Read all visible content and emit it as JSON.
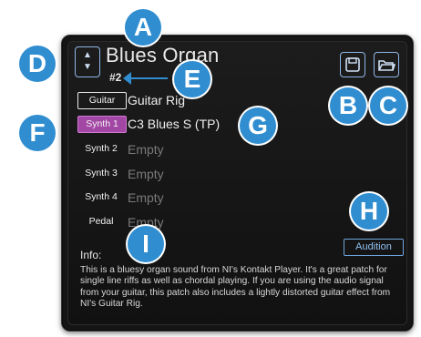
{
  "preset": {
    "name": "Blues Organ",
    "number": "#2",
    "spin_up": "▲",
    "spin_down": "▼"
  },
  "toolbar": {
    "save_icon": "save-icon",
    "open_icon": "folder-open-icon"
  },
  "slots": [
    {
      "label": "Guitar",
      "value": "Guitar Rig",
      "state": "loaded"
    },
    {
      "label": "Synth 1",
      "value": "C3 Blues S (TP)",
      "state": "selected"
    },
    {
      "label": "Synth 2",
      "value": "Empty",
      "state": "empty"
    },
    {
      "label": "Synth 3",
      "value": "Empty",
      "state": "empty"
    },
    {
      "label": "Synth 4",
      "value": "Empty",
      "state": "empty"
    },
    {
      "label": "Pedal",
      "value": "Empty",
      "state": "empty"
    }
  ],
  "info": {
    "label": "Info:",
    "text": "This is a bluesy organ sound from NI's Kontakt Player. It's a great patch for single line riffs as well as chordal playing. If you are using the audio signal from your guitar, this patch also includes a lightly distorted guitar effect from NI's Guitar Rig."
  },
  "audition_label": "Audition",
  "callouts": {
    "a": "A",
    "b": "B",
    "c": "C",
    "d": "D",
    "e": "E",
    "f": "F",
    "g": "G",
    "h": "H",
    "i": "I"
  },
  "colors": {
    "accent_blue": "#2f8dd0",
    "selected_purple": "#a347a5",
    "panel_bg": "#151515"
  }
}
